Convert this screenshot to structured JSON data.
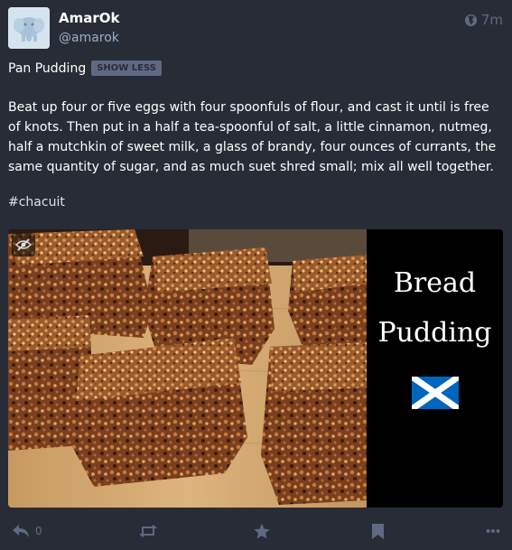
{
  "account": {
    "display_name": "AmarOk",
    "handle": "@amarok",
    "avatar_icon": "elephant-icon"
  },
  "time": {
    "relative": "7m",
    "visibility_icon": "globe-icon"
  },
  "spoiler": {
    "text": "Pan Pudding",
    "toggle_label": "SHOW LESS"
  },
  "content": {
    "body": "Beat up four or five eggs with four spoonfuls of flour, and cast it until is free of knots. Then put in a half a tea-spoonful of salt, a little cinnamon, nutmeg, half a mutchkin of sweet milk, a glass of brandy, four ounces of currants, the same quantity of sugar, and as much suet shred small; mix all well together.",
    "hashtag": "#chacuit"
  },
  "media": {
    "hide_icon": "eye-slash-icon",
    "title_line1": "Bread",
    "title_line2": "Pudding",
    "flag_icon": "scotland-flag-icon"
  },
  "action_bar": {
    "reply_count": "0",
    "icons": [
      "reply-icon",
      "boost-icon",
      "favourite-icon",
      "bookmark-icon",
      "more-icon"
    ]
  },
  "colors": {
    "background": "#282c37",
    "muted": "#606984",
    "handle": "#9baec8",
    "text": "#ffffff"
  }
}
